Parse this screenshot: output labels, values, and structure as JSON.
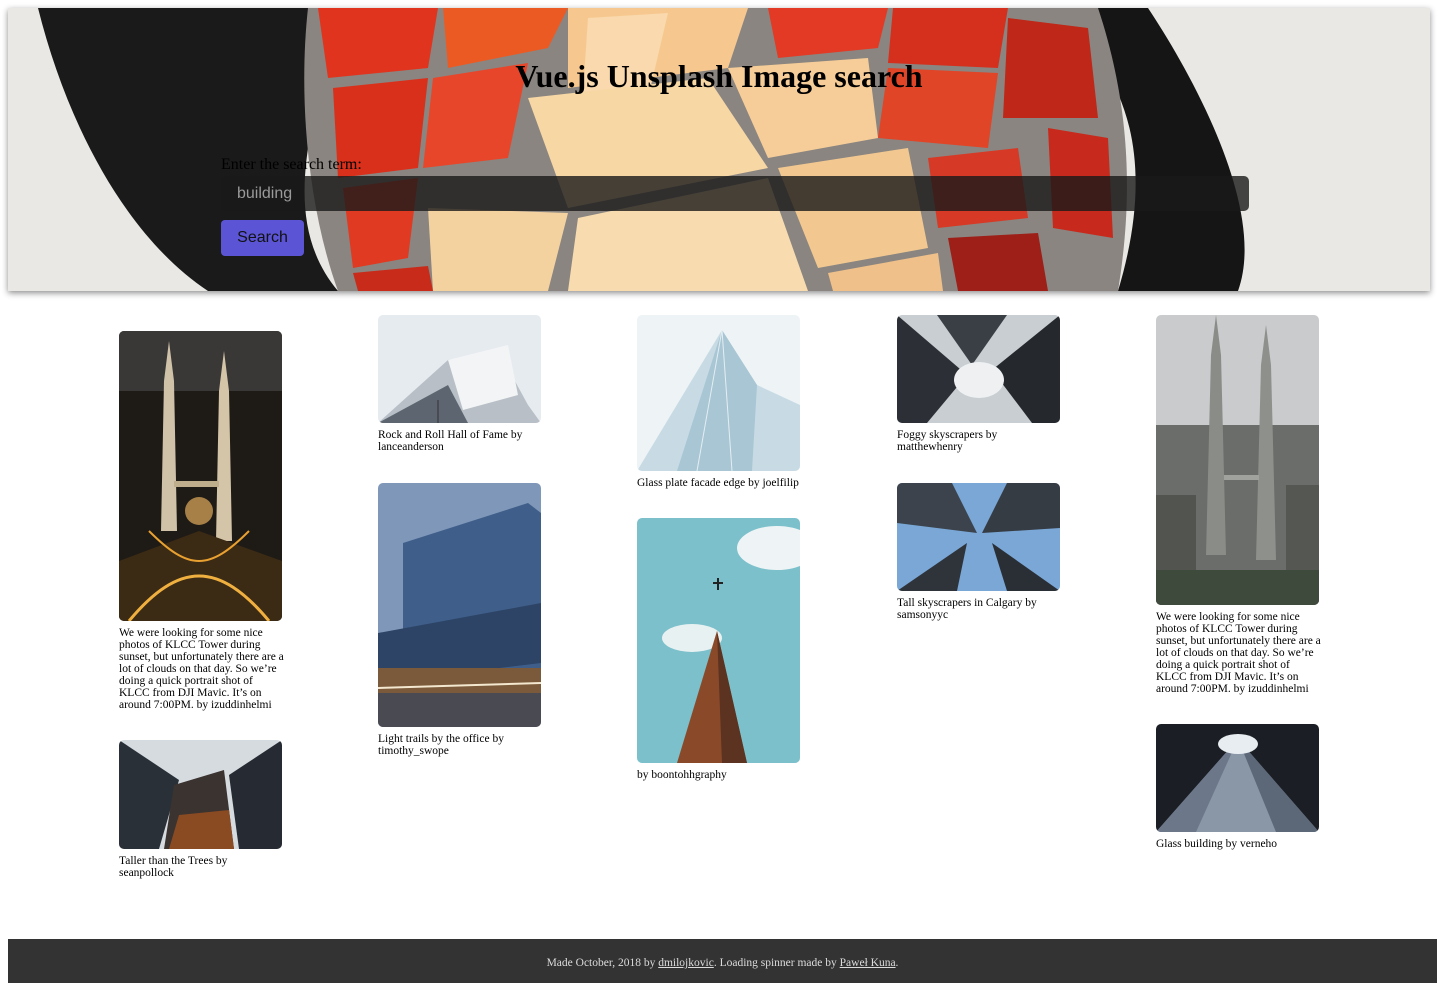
{
  "header": {
    "title": "Vue.js Unsplash Image search",
    "search_label": "Enter the search term:",
    "search_value": "building",
    "search_button": "Search"
  },
  "columns": [
    [
      {
        "caption": "We were looking for some nice photos of KLCC Tower during sunset, but unfortunately there are a lot of clouds on that day. So we’re doing a quick portrait shot of KLCC from DJI Mavic. It’s on around 7:00PM. by izuddinhelmi",
        "image": "klcc-towers-night-aerial"
      },
      {
        "caption": "Taller than the Trees by seanpollock",
        "image": "skyscrapers-looking-up"
      }
    ],
    [
      {
        "caption": "Rock and Roll Hall of Fame by lanceanderson",
        "image": "rock-and-roll-hall-of-fame"
      },
      {
        "caption": "Light trails by the office by timothy_swope",
        "image": "glass-office-light-trails"
      }
    ],
    [
      {
        "caption": "Glass plate facade edge by joelfilip",
        "image": "glass-facade-edge"
      },
      {
        "caption": "by boontohhgraphy",
        "image": "tower-with-airplane"
      }
    ],
    [
      {
        "caption": "Foggy skyscrapers by matthewhenry",
        "image": "foggy-skyscrapers"
      },
      {
        "caption": "Tall skyscrapers in Calgary by samsonyyc",
        "image": "calgary-skyscrapers"
      }
    ],
    [
      {
        "caption": "We were looking for some nice photos of KLCC Tower during sunset, but unfortunately there are a lot of clouds on that day. So we’re doing a quick portrait shot of KLCC from DJI Mavic. It’s on around 7:00PM. by izuddinhelmi",
        "image": "klcc-towers-day"
      },
      {
        "caption": "Glass building by verneho",
        "image": "glass-building-looking-up"
      }
    ]
  ],
  "footer": {
    "prefix": "Made October, 2018 by ",
    "author_link": "dmilojkovic",
    "middle": ". Loading spinner made by ",
    "spinner_link": "Paweł Kuna",
    "suffix": "."
  }
}
